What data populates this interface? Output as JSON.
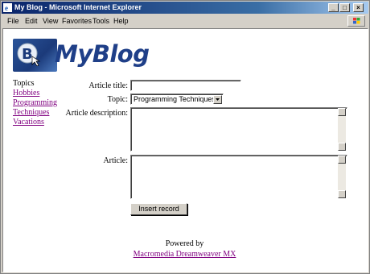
{
  "window": {
    "title": "My Blog - Microsoft Internet Explorer",
    "min": "_",
    "max": "□",
    "close": "×"
  },
  "menu": [
    "File",
    "Edit",
    "View",
    "Favorites",
    "Tools",
    "Help"
  ],
  "banner": {
    "brand": "MyBlog"
  },
  "sidebar": {
    "heading": "Topics",
    "links": [
      "Hobbies",
      "Programming",
      "Techniques",
      "Vacations"
    ]
  },
  "form": {
    "title_label": "Article title:",
    "title_value": "",
    "topic_label": "Topic:",
    "topic_value": "Programming Techniques",
    "description_label": "Article description:",
    "description_value": "",
    "article_label": "Article:",
    "article_value": "",
    "submit_label": "Insert record"
  },
  "footer": {
    "powered_by": "Powered by",
    "link": "Macromedia Dreamweaver MX"
  },
  "colors": {
    "titlebar": "#0a246a",
    "visited_link": "#800080",
    "brand": "#1f3f88"
  }
}
